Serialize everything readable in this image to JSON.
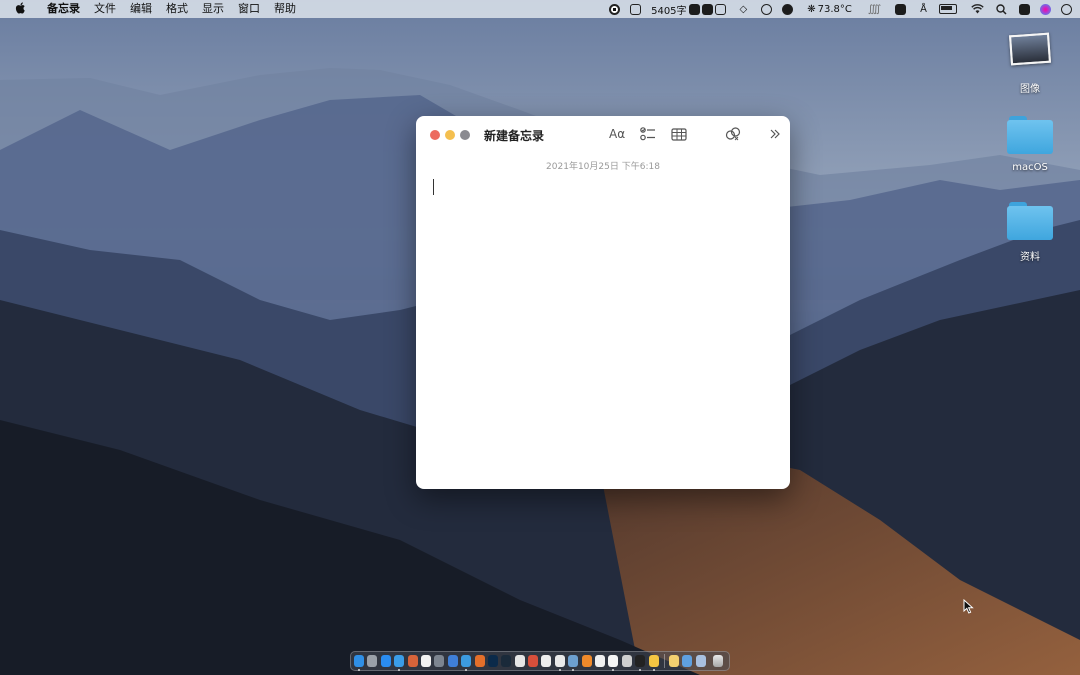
{
  "menubar": {
    "app_name": "备忘录",
    "menus": [
      "文件",
      "编辑",
      "格式",
      "显示",
      "窗口",
      "帮助"
    ],
    "word_count": "5405字",
    "temperature": "73.8°C"
  },
  "desktop_icons": [
    {
      "label": "图像",
      "kind": "image"
    },
    {
      "label": "macOS",
      "kind": "folder"
    },
    {
      "label": "资料",
      "kind": "folder"
    }
  ],
  "notes_window": {
    "title": "新建备忘录",
    "format_label": "Aα",
    "date": "2021年10月25日 下午6:18",
    "body": ""
  },
  "dock": {
    "apps": [
      {
        "name": "finder",
        "color": "#2f8fe6",
        "on": true
      },
      {
        "name": "launchpad",
        "color": "#9aa0a8",
        "on": false
      },
      {
        "name": "app-store",
        "color": "#2a8cf0",
        "on": false
      },
      {
        "name": "safari",
        "color": "#3b9de8",
        "on": true
      },
      {
        "name": "photo-booth",
        "color": "#d8643a",
        "on": false
      },
      {
        "name": "calendar",
        "color": "#f2f2f2",
        "on": false
      },
      {
        "name": "preferences",
        "color": "#7d8590",
        "on": false
      },
      {
        "name": "xcode",
        "color": "#3f7fd8",
        "on": false
      },
      {
        "name": "browser",
        "color": "#3c9be0",
        "on": true
      },
      {
        "name": "firefox",
        "color": "#e46f2a",
        "on": false
      },
      {
        "name": "photoshop",
        "color": "#0b2a4a",
        "on": false
      },
      {
        "name": "lightroom",
        "color": "#1a2a3a",
        "on": false
      },
      {
        "name": "wechat",
        "color": "#e6e6e6",
        "on": false
      },
      {
        "name": "qq",
        "color": "#d84f3b",
        "on": false
      },
      {
        "name": "clock",
        "color": "#eeeeee",
        "on": false
      },
      {
        "name": "chrome",
        "color": "#e9e9e9",
        "on": true
      },
      {
        "name": "network",
        "color": "#6da0d0",
        "on": true
      },
      {
        "name": "books",
        "color": "#f08a2a",
        "on": false
      },
      {
        "name": "typora",
        "color": "#f0f0f0",
        "on": false
      },
      {
        "name": "text-editor",
        "color": "#f5f5f5",
        "on": true
      },
      {
        "name": "notes-gray",
        "color": "#cfcfcf",
        "on": false
      },
      {
        "name": "terminal",
        "color": "#222222",
        "on": true
      },
      {
        "name": "notes",
        "color": "#f5c542",
        "on": true
      }
    ],
    "docs": [
      {
        "name": "doc-folder",
        "color": "#f3d070"
      },
      {
        "name": "doc-image",
        "color": "#5fa0e0"
      },
      {
        "name": "doc-screen",
        "color": "#a8c0e0"
      }
    ]
  }
}
